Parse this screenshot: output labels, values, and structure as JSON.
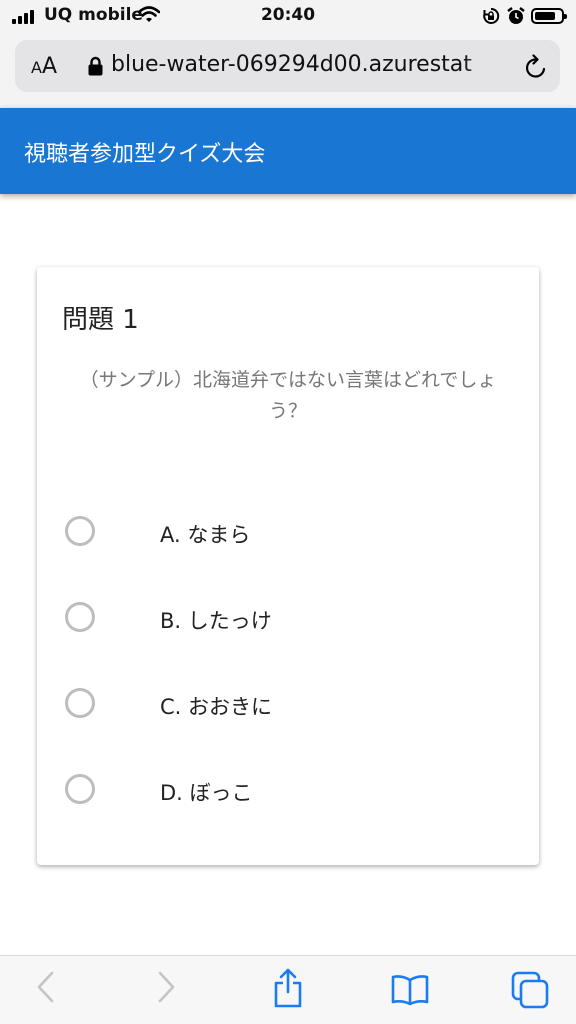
{
  "status_bar": {
    "carrier": "UQ mobile",
    "time": "20:40",
    "battery_level": 0.8,
    "icons": [
      "signal-icon",
      "wifi-icon",
      "rotation-lock-icon",
      "alarm-icon",
      "battery-icon"
    ]
  },
  "browser": {
    "text_size_label": "AA",
    "url": "blue-water-069294d00.azurestat",
    "icons": [
      "padlock-icon",
      "reload-icon"
    ]
  },
  "app": {
    "title": "視聴者参加型クイズ大会",
    "accent_color": "#1976d2"
  },
  "quiz": {
    "question_title": "問題 1",
    "question_text": "（サンプル）北海道弁ではない言葉はどれでしょう？",
    "options": [
      {
        "label": "A. なまら"
      },
      {
        "label": "B. したっけ"
      },
      {
        "label": "C. おおきに"
      },
      {
        "label": "D. ぼっこ"
      }
    ]
  },
  "toolbar": {
    "icons": [
      "back-icon",
      "forward-icon",
      "share-icon",
      "bookmarks-icon",
      "tabs-icon"
    ]
  }
}
